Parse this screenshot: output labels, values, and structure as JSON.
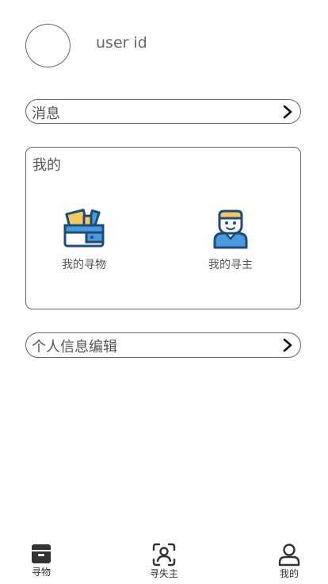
{
  "profile": {
    "user_id_label": "user id"
  },
  "menu": {
    "messages_label": "消息",
    "edit_profile_label": "个人信息编辑"
  },
  "mine_card": {
    "title": "我的",
    "items": [
      {
        "label": "我的寻物",
        "icon": "box-of-items-icon"
      },
      {
        "label": "我的寻主",
        "icon": "person-icon"
      }
    ]
  },
  "tabbar": {
    "tabs": [
      {
        "label": "寻物",
        "icon": "box-icon"
      },
      {
        "label": "寻失主",
        "icon": "face-scan-icon"
      },
      {
        "label": "我的",
        "icon": "user-icon"
      }
    ]
  },
  "colors": {
    "icon_dark": "#1f4b7a",
    "icon_yellow": "#f4c95d",
    "icon_blue": "#4a9ae0",
    "border": "#666666"
  }
}
